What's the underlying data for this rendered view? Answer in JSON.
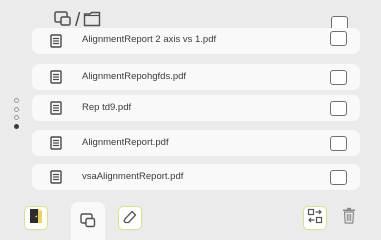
{
  "header": {
    "path_separator": "/"
  },
  "files": [
    {
      "name": "AlignmentReport 2 axis vs 1.pdf"
    },
    {
      "name": "AlignmentRepohgfds.pdf"
    },
    {
      "name": "Rep td9.pdf"
    },
    {
      "name": "AlignmentReport.pdf"
    },
    {
      "name": "vsaAlignmentReport.pdf"
    }
  ],
  "pager": {
    "pages": 4,
    "current": 4
  },
  "colors": {
    "accent_border": "#d6e580",
    "exit_icon_accent": "#f2d35a",
    "row_background": "#f9f9f9",
    "panel_background": "#ebebeb"
  },
  "toolbar": {
    "buttons": [
      "exit-icon",
      "drive-tab-icon",
      "eraser-icon",
      "swap-icon",
      "trash-icon"
    ]
  }
}
